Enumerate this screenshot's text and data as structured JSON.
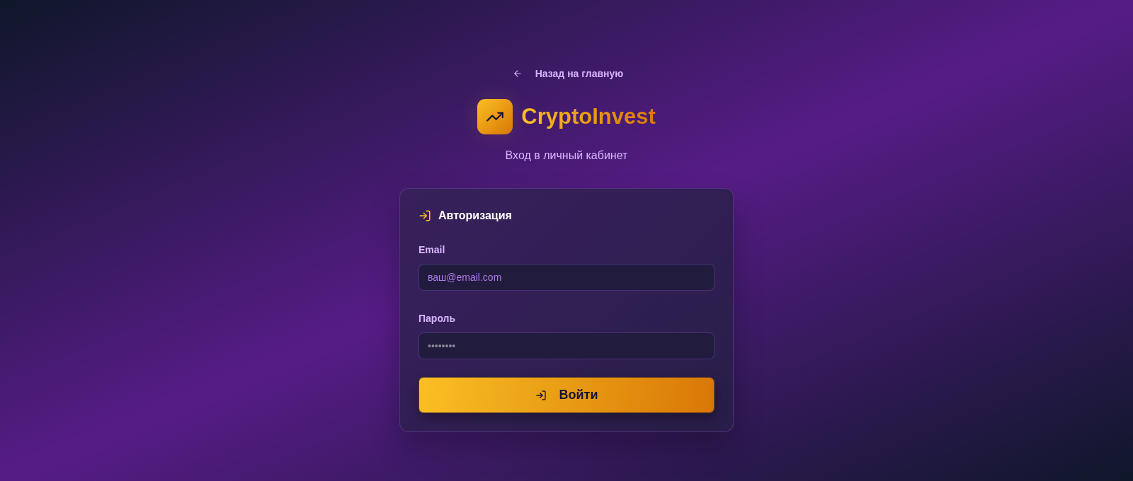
{
  "back_link": {
    "label": "Назад на главную"
  },
  "brand": {
    "name": "CryptoInvest",
    "subtitle": "Вход в личный кабинет"
  },
  "card": {
    "title": "Авторизация",
    "fields": [
      {
        "kind": "email",
        "label": "Email",
        "placeholder": "ваш@email.com"
      },
      {
        "kind": "password",
        "label": "Пароль",
        "placeholder": "••••••••"
      }
    ],
    "submit": {
      "label": "Войти"
    }
  }
}
